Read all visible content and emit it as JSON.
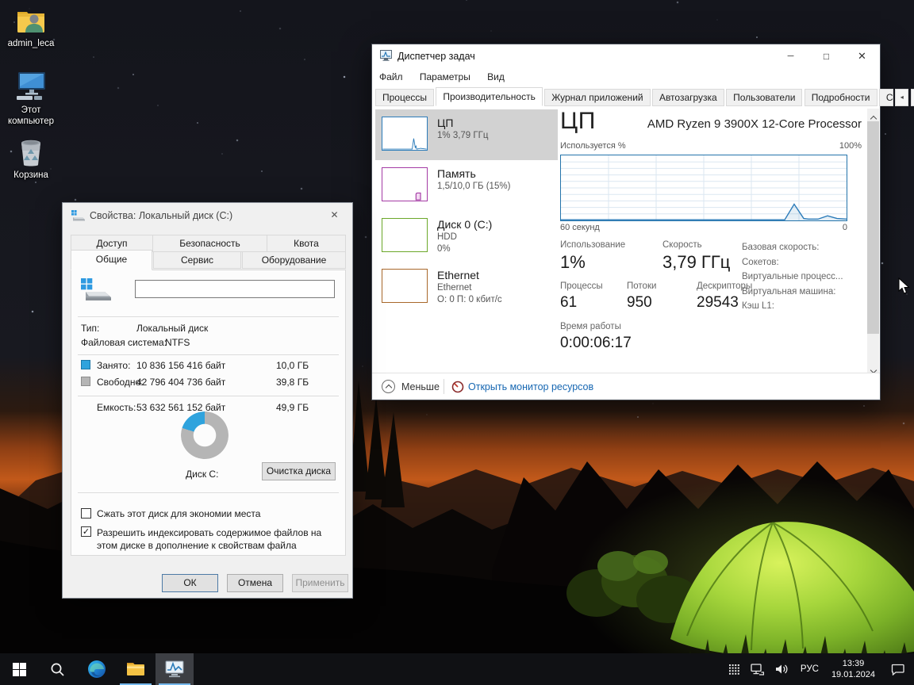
{
  "chart_data": {
    "type": "line",
    "title": "ЦП — Используется %",
    "ylabel": "Используется %",
    "ylim": [
      0,
      100
    ],
    "x_range_seconds": 60,
    "x_left_label": "60 секунд",
    "x_right_label": "0",
    "y_max_label": "100%",
    "grid": true,
    "series_color": "#2b7bb9",
    "points": [
      [
        60,
        1
      ],
      [
        56,
        1
      ],
      [
        52,
        1
      ],
      [
        48,
        1
      ],
      [
        44,
        1
      ],
      [
        40,
        1
      ],
      [
        36,
        1
      ],
      [
        32,
        1
      ],
      [
        28,
        1
      ],
      [
        24,
        1
      ],
      [
        20,
        1
      ],
      [
        16,
        1
      ],
      [
        13,
        1
      ],
      [
        11,
        25
      ],
      [
        9,
        3
      ],
      [
        8,
        2
      ],
      [
        6,
        2
      ],
      [
        4,
        7
      ],
      [
        2,
        3
      ],
      [
        0,
        2
      ]
    ]
  },
  "desktop": {
    "icons": [
      {
        "label": "admin_leca"
      },
      {
        "label": "Этот компьютер"
      },
      {
        "label": "Корзина"
      }
    ]
  },
  "task_manager": {
    "title": "Диспетчер задач",
    "menu": {
      "file": "Файл",
      "options": "Параметры",
      "view": "Вид"
    },
    "tabs": [
      "Процессы",
      "Производительность",
      "Журнал приложений",
      "Автозагрузка",
      "Пользователи",
      "Подробности",
      "С"
    ],
    "active_tab": "Производительность",
    "sidebar": {
      "cpu": {
        "title": "ЦП",
        "sub": "1% 3,79 ГГц"
      },
      "memory": {
        "title": "Память",
        "sub": "1,5/10,0 ГБ (15%)"
      },
      "disk": {
        "title": "Диск 0 (C:)",
        "sub": "HDD",
        "sub2": "0%"
      },
      "ethernet": {
        "title": "Ethernet",
        "sub": "Ethernet",
        "sub2": "О: 0 П: 0 кбит/с"
      }
    },
    "cpu_panel": {
      "heading": "ЦП",
      "cpu_name": "AMD Ryzen 9 3900X 12-Core Processor",
      "graph_label": "Используется %",
      "graph_max": "100%",
      "graph_left": "60 секунд",
      "graph_right": "0",
      "stats": {
        "usage_label": "Использование",
        "usage_value": "1%",
        "speed_label": "Скорость",
        "speed_value": "3,79 ГГц",
        "processes_label": "Процессы",
        "processes_value": "61",
        "threads_label": "Потоки",
        "threads_value": "950",
        "handles_label": "Дескрипторы",
        "handles_value": "29543",
        "uptime_label": "Время работы",
        "uptime_value": "0:00:06:17"
      },
      "right_info": [
        "Базовая скорость:",
        "Сокетов:",
        "Виртуальные процесс...",
        "Виртуальная машина:",
        "Кэш L1:"
      ]
    },
    "footer": {
      "less": "Меньше",
      "resource_monitor": "Открыть монитор ресурсов"
    }
  },
  "properties_dialog": {
    "title": "Свойства: Локальный диск (C:)",
    "tabs_back": [
      "Доступ",
      "Безопасность",
      "Квота"
    ],
    "tabs_front": [
      "Общие",
      "Сервис",
      "Оборудование"
    ],
    "active_tab": "Общие",
    "label_input_value": "",
    "type_label": "Тип:",
    "type_value": "Локальный диск",
    "fs_label": "Файловая система:",
    "fs_value": "NTFS",
    "used_label": "Занято:",
    "used_bytes": "10 836 156 416 байт",
    "used_gb": "10,0 ГБ",
    "free_label": "Свободно:",
    "free_bytes": "42 796 404 736 байт",
    "free_gb": "39,8 ГБ",
    "capacity_label": "Емкость:",
    "capacity_bytes": "53 632 561 152 байт",
    "capacity_gb": "49,9 ГБ",
    "used_percent": 20,
    "disk_chart_label": "Диск C:",
    "cleanup_button": "Очистка диска",
    "checkbox_compress": {
      "label": "Сжать этот диск для экономии места",
      "checked": false
    },
    "checkbox_index": {
      "label": "Разрешить индексировать содержимое файлов на этом диске в дополнение к свойствам файла",
      "checked": true
    },
    "buttons": {
      "ok": "ОК",
      "cancel": "Отмена",
      "apply": "Применить"
    }
  },
  "taskbar": {
    "language": "РУС",
    "time": "13:39",
    "date": "19.01.2024"
  },
  "colors": {
    "cpu_accent": "#2b7bb9",
    "memory_accent": "#a43ba5",
    "disk_accent": "#6ca82a",
    "ethernet_accent": "#a8682b",
    "used_blue": "#2fa3dd",
    "free_gray": "#b5b5b5",
    "link_blue": "#1767b2"
  }
}
